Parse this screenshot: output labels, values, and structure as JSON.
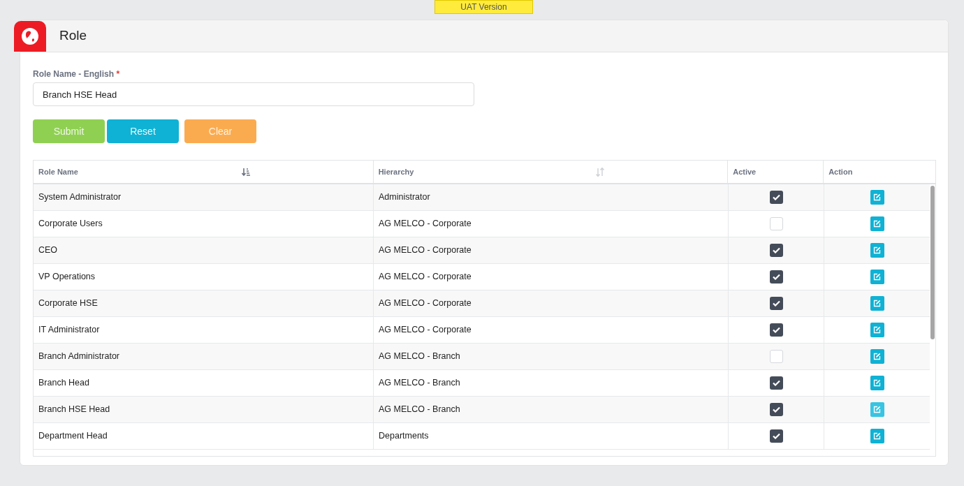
{
  "environment_badge": "UAT Version",
  "page": {
    "title": "Role"
  },
  "form": {
    "label": "Role Name - English",
    "required_mark": "*",
    "value": "Branch HSE Head"
  },
  "buttons": [
    {
      "label": "Submit",
      "kind": "submit"
    },
    {
      "label": "Reset",
      "kind": "reset"
    },
    {
      "label": "Clear",
      "kind": "clear"
    }
  ],
  "table": {
    "columns": [
      {
        "label": "Role Name",
        "sorted": true
      },
      {
        "label": "Hierarchy",
        "sorted": false
      },
      {
        "label": "Active"
      },
      {
        "label": "Action"
      }
    ],
    "rows": [
      {
        "role": "System Administrator",
        "hierarchy": "Administrator",
        "active": true,
        "selected": false
      },
      {
        "role": "Corporate Users",
        "hierarchy": "AG MELCO - Corporate",
        "active": false,
        "selected": false
      },
      {
        "role": "CEO",
        "hierarchy": "AG MELCO - Corporate",
        "active": true,
        "selected": false
      },
      {
        "role": "VP Operations",
        "hierarchy": "AG MELCO - Corporate",
        "active": true,
        "selected": false
      },
      {
        "role": "Corporate HSE",
        "hierarchy": "AG MELCO - Corporate",
        "active": true,
        "selected": false
      },
      {
        "role": "IT Administrator",
        "hierarchy": "AG MELCO - Corporate",
        "active": true,
        "selected": false
      },
      {
        "role": "Branch Administrator",
        "hierarchy": "AG MELCO - Branch",
        "active": false,
        "selected": false
      },
      {
        "role": "Branch Head",
        "hierarchy": "AG MELCO - Branch",
        "active": true,
        "selected": false
      },
      {
        "role": "Branch HSE Head",
        "hierarchy": "AG MELCO - Branch",
        "active": true,
        "selected": true
      },
      {
        "role": "Department Head",
        "hierarchy": "Departments",
        "active": true,
        "selected": false
      }
    ]
  }
}
